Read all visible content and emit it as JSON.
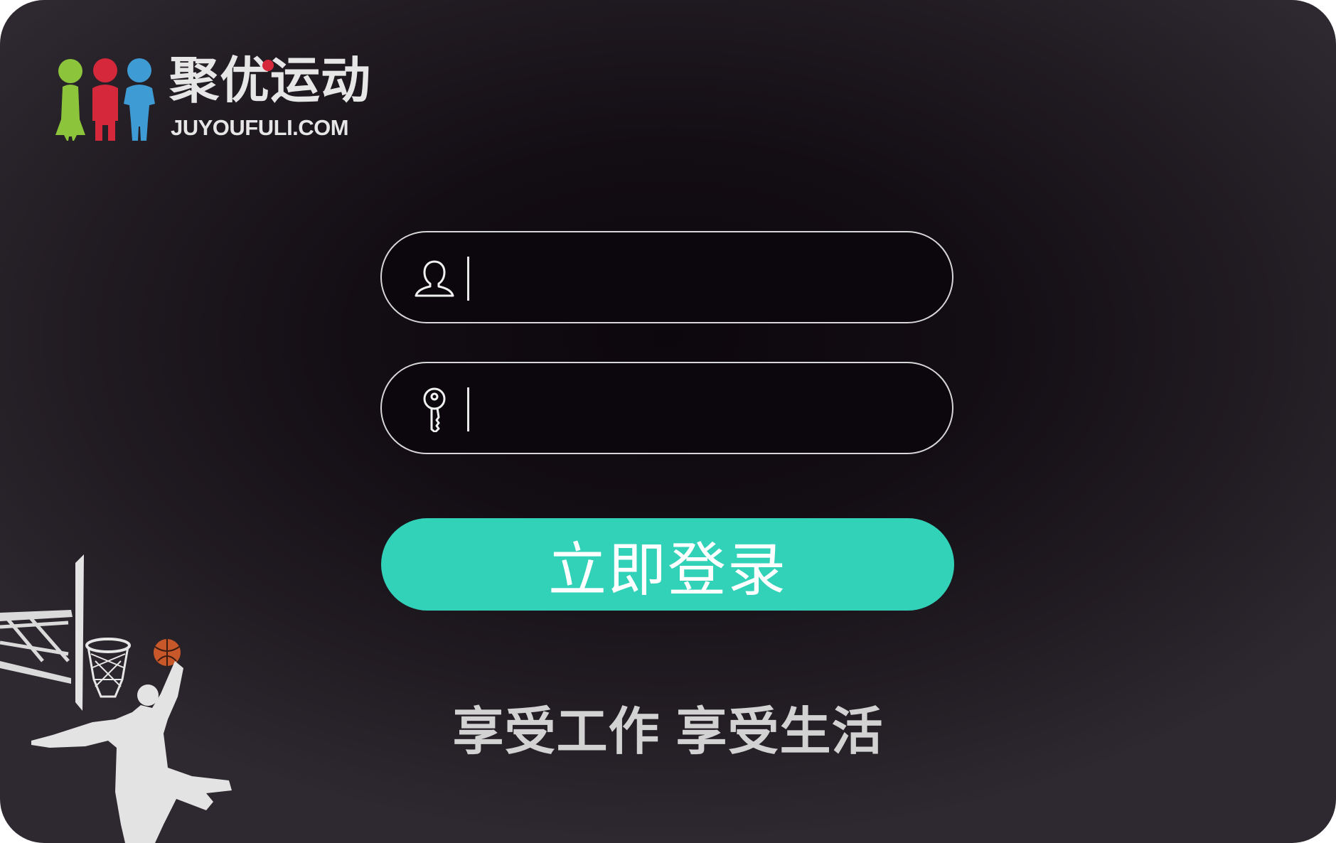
{
  "logo": {
    "name_cn": "聚优运动",
    "domain": "JUYOUFULI.COM",
    "colors": {
      "figure_green": "#8cc43c",
      "figure_red": "#d6283b",
      "figure_blue": "#3e9bd4",
      "text": "#e6e6e6"
    }
  },
  "form": {
    "username": {
      "icon": "user-icon",
      "value": "",
      "placeholder": ""
    },
    "password": {
      "icon": "key-icon",
      "value": "",
      "placeholder": ""
    },
    "login_button": {
      "label": "立即登录",
      "color": "#32d2b9"
    }
  },
  "slogan": {
    "part1": "享受工作",
    "part2": "享受生活"
  },
  "decoration": {
    "icon": "basketball-player-icon"
  }
}
